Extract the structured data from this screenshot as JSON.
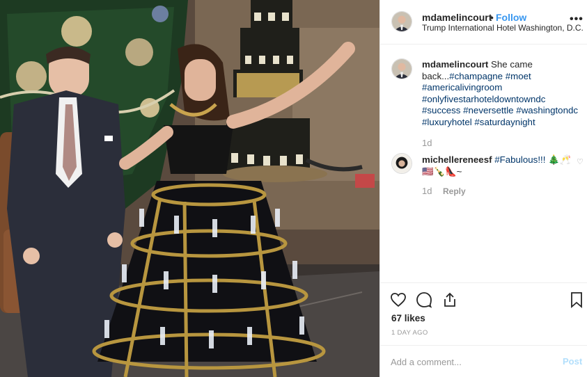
{
  "post": {
    "username": "mdamelincourt",
    "separator": "•",
    "follow_label": "Follow",
    "location": "Trump International Hotel Washington, D.C.",
    "more_label": "•••",
    "image_alt": "man in suit standing next to woman in black gown whose skirt frame holds champagne flutes, Christmas tree and champagne bottle tower behind"
  },
  "caption": {
    "username": "mdamelincourt",
    "text": "She came back...",
    "hashtags": [
      "#champagne",
      "#moet",
      "#americalivingroom",
      "#onlyfivestarhoteldowntowndc",
      "#success",
      "#neversettle",
      "#washingtondc",
      "#luxuryhotel",
      "#saturdaynight"
    ],
    "time": "1d"
  },
  "comment": {
    "username": "michellereneesf",
    "hashtag": "#Fabulous!!!",
    "emoji": "🎄🥂🇺🇸🍾👠~",
    "time": "1d",
    "reply_label": "Reply",
    "heart_icon": "heart-outline-icon"
  },
  "stats": {
    "likes": "67 likes",
    "posted": "1 DAY AGO"
  },
  "add_comment": {
    "placeholder": "Add a comment...",
    "post_label": "Post"
  },
  "colors": {
    "link": "#3897f0",
    "hashtag": "#003569",
    "muted": "#999999",
    "post_disabled": "#b2dffc",
    "border": "#efefef"
  }
}
